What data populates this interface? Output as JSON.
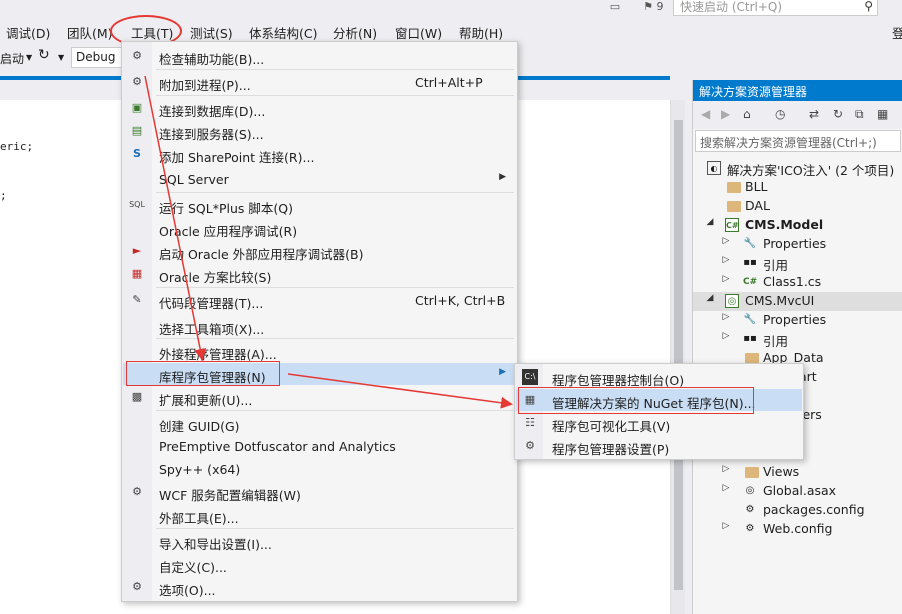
{
  "quick_launch": {
    "placeholder": "快速启动 (Ctrl+Q)",
    "notifications_count": "9"
  },
  "menubar": {
    "items": [
      "调试(D)",
      "团队(M)",
      "工具(T)",
      "测试(S)",
      "体系结构(C)",
      "分析(N)",
      "窗口(W)",
      "帮助(H)"
    ],
    "right_label": "登"
  },
  "toolbar": {
    "start_label": "启动",
    "config_value": "Debug"
  },
  "editor": {
    "code_lines": [
      "eric;",
      ";"
    ]
  },
  "tools_menu": {
    "items": [
      {
        "label": "检查辅助功能(B)...",
        "shortcut": ""
      },
      {
        "label": "附加到进程(P)...",
        "shortcut": "Ctrl+Alt+P"
      },
      {
        "label": "连接到数据库(D)...",
        "shortcut": ""
      },
      {
        "label": "连接到服务器(S)...",
        "shortcut": ""
      },
      {
        "label": "添加 SharePoint 连接(R)...",
        "shortcut": ""
      },
      {
        "label": "SQL Server",
        "shortcut": ""
      },
      {
        "label": "运行 SQL*Plus 脚本(Q)",
        "shortcut": ""
      },
      {
        "label": "Oracle 应用程序调试(R)",
        "shortcut": ""
      },
      {
        "label": "启动 Oracle 外部应用程序调试器(B)",
        "shortcut": ""
      },
      {
        "label": "Oracle 方案比较(S)",
        "shortcut": ""
      },
      {
        "label": "代码段管理器(T)...",
        "shortcut": "Ctrl+K, Ctrl+B"
      },
      {
        "label": "选择工具箱项(X)...",
        "shortcut": ""
      },
      {
        "label": "外接程序管理器(A)...",
        "shortcut": ""
      },
      {
        "label": "库程序包管理器(N)",
        "shortcut": ""
      },
      {
        "label": "扩展和更新(U)...",
        "shortcut": ""
      },
      {
        "label": "创建 GUID(G)",
        "shortcut": ""
      },
      {
        "label": "PreEmptive Dotfuscator and Analytics",
        "shortcut": ""
      },
      {
        "label": "Spy++ (x64)",
        "shortcut": ""
      },
      {
        "label": "WCF 服务配置编辑器(W)",
        "shortcut": ""
      },
      {
        "label": "外部工具(E)...",
        "shortcut": ""
      },
      {
        "label": "导入和导出设置(I)...",
        "shortcut": ""
      },
      {
        "label": "自定义(C)...",
        "shortcut": ""
      },
      {
        "label": "选项(O)...",
        "shortcut": ""
      }
    ]
  },
  "package_submenu": {
    "items": [
      {
        "label": "程序包管理器控制台(O)"
      },
      {
        "label": "管理解决方案的 NuGet 程序包(N)..."
      },
      {
        "label": "程序包可视化工具(V)"
      },
      {
        "label": "程序包管理器设置(P)"
      }
    ]
  },
  "solution_explorer": {
    "title": "解决方案资源管理器",
    "search_placeholder": "搜索解决方案资源管理器(Ctrl+;)",
    "tree": [
      "解决方案'ICO注入' (2 个项目)",
      "BLL",
      "DAL",
      "CMS.Model",
      "Properties",
      "引用",
      "Class1.cs",
      "CMS.MvcUI",
      "Properties",
      "引用",
      "App_Data",
      "art",
      "t",
      "lers",
      "Views",
      "Global.asax",
      "packages.config",
      "Web.config"
    ]
  },
  "colors": {
    "accent": "#007acc",
    "highlight": "#c9def5",
    "annotation": "#e53935"
  }
}
